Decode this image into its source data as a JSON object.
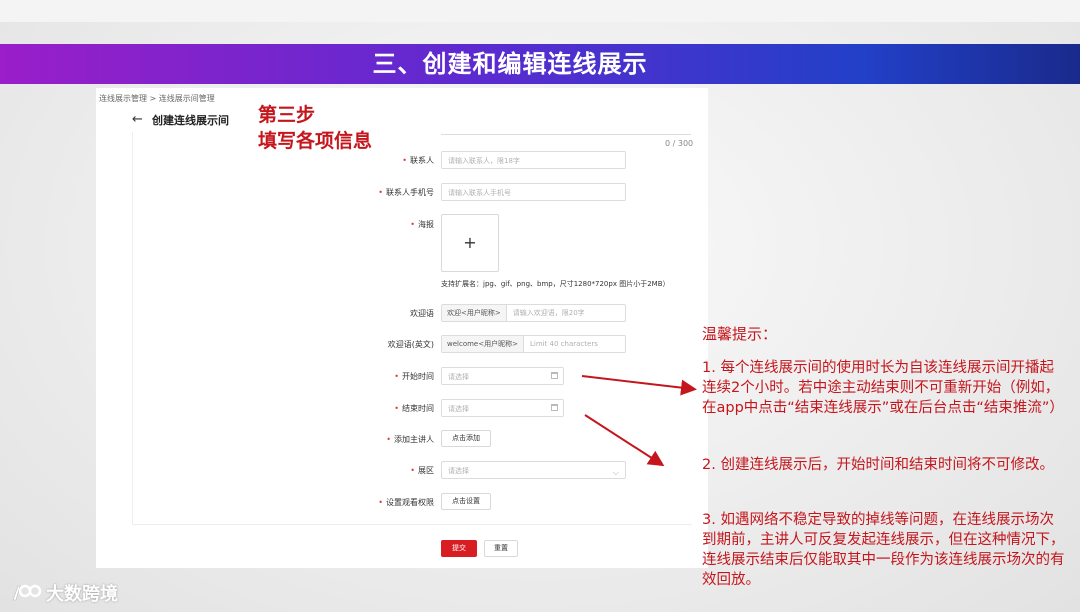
{
  "slide": {
    "title": "三、创建和编辑连线展示"
  },
  "screenshot": {
    "breadcrumb": "连线展示管理 > 连线展示间管理",
    "back_arrow": "←",
    "page_title": "创建连线展示间",
    "char_counter": "0 / 300",
    "fields": {
      "contact": {
        "label": "联系人",
        "placeholder": "请输入联系人，限18字"
      },
      "phone": {
        "label": "联系人手机号",
        "placeholder": "请输入联系人手机号"
      },
      "poster": {
        "label": "海报",
        "upload_symbol": "+",
        "hint": "支持扩展名：jpg、gif、png、bmp，尺寸1280*720px 图片小于2MB）"
      },
      "welcome": {
        "label": "欢迎语",
        "prefix": "欢迎<用户昵称>",
        "placeholder": "请输入欢迎语，限20字"
      },
      "welcome_en": {
        "label": "欢迎语(英文)",
        "prefix": "welcome<用户昵称>",
        "placeholder": "Limit 40 characters"
      },
      "start_time": {
        "label": "开始时间",
        "placeholder": "请选择"
      },
      "end_time": {
        "label": "结束时间",
        "placeholder": "请选择"
      },
      "speaker": {
        "label": "添加主讲人",
        "button": "点击添加"
      },
      "hall": {
        "label": "展区",
        "placeholder": "请选择",
        "chevron": "⌵"
      },
      "permission": {
        "label": "设置观看权限",
        "button": "点击设置"
      }
    },
    "submit_button": "提交",
    "reset_button": "重置"
  },
  "step": {
    "line1": "第三步",
    "line2": "填写各项信息"
  },
  "tips": {
    "title": "温馨提示：",
    "items": [
      "1. 每个连线展示间的使用时长为自该连线展示间开播起连续2个小时。若中途主动结束则不可重新开始（例如，在app中点击“结束连线展示”或在后台点击“结束推流”）",
      "2. 创建连线展示后，开始时间和结束时间将不可修改。",
      "3. 如遇网络不稳定导致的掉线等问题，在连线展示场次到期前，主讲人可反复发起连线展示，但在这种情况下，连线展示结束后仅能取其中一段作为该连线展示场次的有效回放。"
    ]
  },
  "logo": {
    "text": "大数跨境"
  },
  "colors": {
    "accent_red": "#c4161c",
    "title_gradient_start": "#9a1ec9",
    "title_gradient_end": "#1a2a8c",
    "primary_button": "#d81e22"
  }
}
